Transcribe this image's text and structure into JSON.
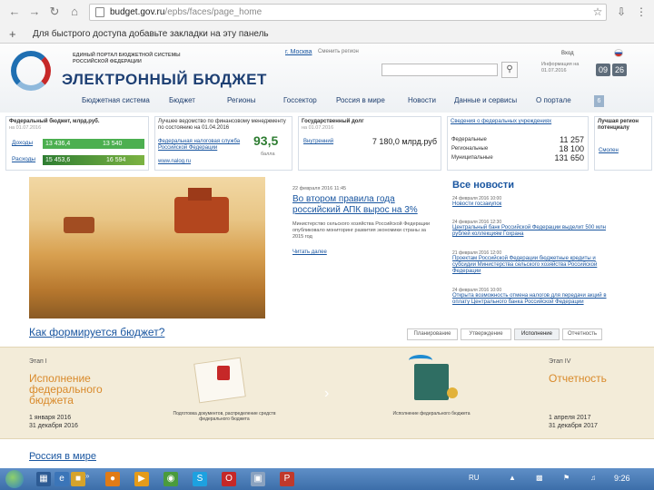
{
  "browser": {
    "url_host": "budget.gov.ru",
    "url_path": "/epbs/faces/page_home",
    "bookmarks_hint": "Для быстрого доступа добавьте закладки на эту панель"
  },
  "site": {
    "logo_subtitle": "ЕДИНЫЙ ПОРТАЛ БЮДЖЕТНОЙ СИСТЕМЫ РОССИЙСКОЙ ФЕДЕРАЦИИ",
    "logo_title": "ЭЛЕКТРОННЫЙ БЮДЖЕТ",
    "region": "г. Москва",
    "change_region": "Сменить регион",
    "login": "Вход",
    "date_label": "Информация на 01.07.2016",
    "clock": [
      "09",
      "26"
    ],
    "nav": [
      "Бюджетная система",
      "Бюджет",
      "Регионы",
      "Госсектор",
      "Россия в мире",
      "Новости",
      "Данные и сервисы",
      "О портале"
    ],
    "nav_square": "6"
  },
  "panels": {
    "federal": {
      "title": "Федеральный бюджет, млрд.руб.",
      "date": "на 01.07.2016",
      "rows": [
        {
          "label": "Доходы",
          "value": "13 436,4",
          "value2": "13 540"
        },
        {
          "label": "Расходы",
          "value": "15 453,6",
          "value2": "16 594"
        }
      ]
    },
    "rating": {
      "title": "Лучшее ведомство по финансовому менеджменту по состоянию на 01.04.2016",
      "link": "Федеральная налоговая служба Российской Федерации",
      "site": "www.nalog.ru",
      "score": "93,5",
      "score_caption": "балла"
    },
    "debt": {
      "title": "Государственный долг",
      "date": "на 01.07.2016",
      "label": "Внутренний",
      "value": "7 180,0 млрд.руб"
    },
    "institutions": {
      "title": "Сведения о федеральных учреждениях",
      "rows": [
        {
          "label": "Федеральные",
          "value": "11 257"
        },
        {
          "label": "Региональные",
          "value": "18 100"
        },
        {
          "label": "Муниципальные",
          "value": "131 650"
        }
      ]
    },
    "best_practice": {
      "title": "Лучшая регион потенциалу",
      "link": "Смолен"
    }
  },
  "featured": {
    "date": "22 февраля 2016 11:45",
    "title": "Во втором правила года российский АПК вырос на 3%",
    "text": "Министерство сельского хозяйства Российской Федерации опубликовало мониторинг развития экономики страны за 2015 год",
    "more": "Читать далее"
  },
  "news": {
    "heading": "Все новости",
    "items": [
      {
        "date": "24 февраля 2016 10:00",
        "title": "Новости госзакупок"
      },
      {
        "date": "24 февраля 2016 12:30",
        "title": "Центральный банк Российской Федерации выделит 500 млн рублей коллекциям Гохрана"
      },
      {
        "date": "21 февраля 2016 12:00",
        "title": "Проектам Российской Федерации бюджетные кредиты и субсидии Министерства сельского хозяйства Российской Федерации"
      },
      {
        "date": "24 февраля 2016 10:00",
        "title": "Открыта возможность отмена налогов для передачи акций в оплату Центрального банка Российской Федерации"
      }
    ]
  },
  "formation": {
    "title": "Как формируется бюджет?",
    "tabs": [
      "Планирование",
      "Утверждение",
      "Исполнение",
      "Отчетность"
    ],
    "active_tab": "Исполнение",
    "stage_left": {
      "label": "Этап I",
      "name": "Исполнение федерального бюджета",
      "dates": [
        "1 января 2016",
        "31 декабря 2016"
      ]
    },
    "stage_right": {
      "label": "Этап IV",
      "name": "Отчетность",
      "dates": [
        "1 апреля 2017",
        "31 декабря 2017"
      ]
    },
    "caption_left": "Подготовка документов, распределение средств федерального бюджета",
    "caption_right": "Исполнение федерального бюджета"
  },
  "russia_link": "Россия в мире",
  "taskbar": {
    "lang": "RU",
    "time": "9:26"
  },
  "colors": {
    "accent": "#1a56a0",
    "green_bar": "#4caf50",
    "stage_orange": "#d98a2b",
    "taskbar": "#3c6ea9"
  }
}
